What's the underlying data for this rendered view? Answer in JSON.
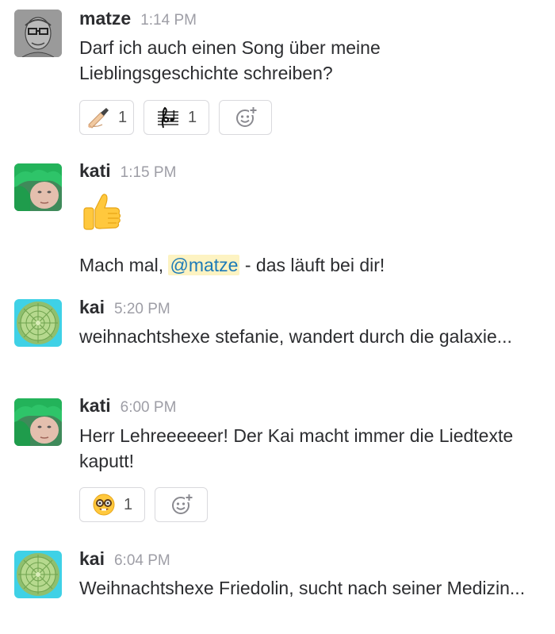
{
  "messages": [
    {
      "author": "matze",
      "time": "1:14 PM",
      "text": "Darf ich auch einen Song über meine Lieblingsgeschichte schreiben?",
      "reactions": [
        {
          "emoji": "writing-hand",
          "count": "1"
        },
        {
          "emoji": "musical-score",
          "count": "1"
        }
      ]
    },
    {
      "author": "kati",
      "time": "1:15 PM",
      "big_emoji": "thumbs-up",
      "text_before": "Mach mal, ",
      "mention": "@matze",
      "text_after": " - das läuft bei dir!"
    },
    {
      "author": "kai",
      "time": "5:20 PM",
      "text": "weihnachtshexe stefanie, wandert durch die galaxie..."
    },
    {
      "author": "kati",
      "time": "6:00 PM",
      "text": "Herr Lehreeeeeer! Der Kai macht immer die Liedtexte kaputt!",
      "reactions": [
        {
          "emoji": "nerd-face",
          "count": "1"
        }
      ]
    },
    {
      "author": "kai",
      "time": "6:04 PM",
      "text": "Weihnachtshexe Friedolin, sucht nach seiner Medizin..."
    }
  ],
  "colors": {
    "author": "#2c2d30",
    "timestamp": "#9e9ea6",
    "mention_text": "#1d7bb8",
    "mention_bg": "#fdf3c2",
    "reaction_border": "#d9d9dd"
  }
}
